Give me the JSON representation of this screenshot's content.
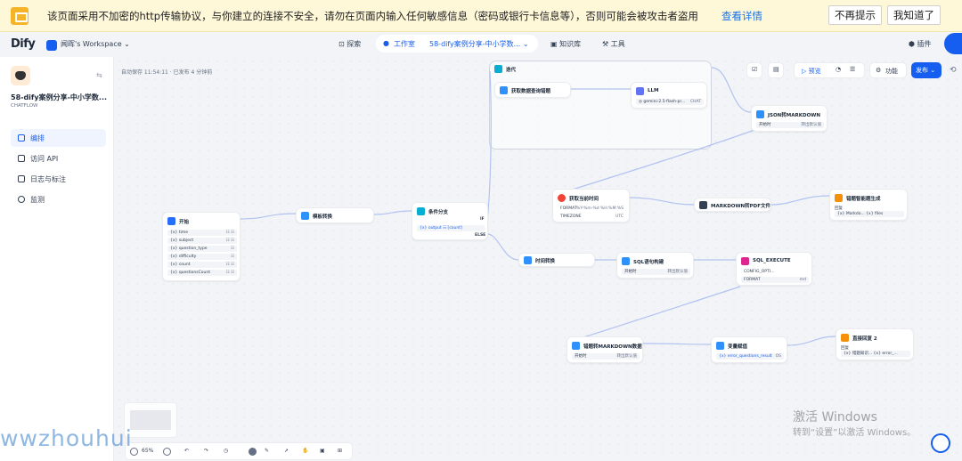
{
  "banner": {
    "text": "该页面采用不加密的http传输协议，与你建立的连接不安全，请勿在页面内输入任何敏感信息（密码或银行卡信息等），否则可能会被攻击者盗用",
    "link": "查看详情",
    "btn_dismiss": "不再提示",
    "btn_ok": "我知道了"
  },
  "topnav": {
    "logo": "Dify",
    "workspace": "闻晖's Workspace ⌄",
    "explore": "探索",
    "studio": "工作室",
    "app_breadcrumb": "58-dify案例分享-中小学数... ⌄",
    "knowledge": "知识库",
    "tools": "工具",
    "plugins": "插件"
  },
  "sidebar": {
    "app_title": "58-dify案例分享-中小学数...",
    "app_mode": "CHATFLOW",
    "items": [
      {
        "label": "编排"
      },
      {
        "label": "访问 API"
      },
      {
        "label": "日志与标注"
      },
      {
        "label": "监测"
      }
    ]
  },
  "canvas": {
    "autosave": "自动保存 11:54:11 · 已发布 4 分钟前",
    "toolbar": {
      "preview": "预览",
      "features": "功能",
      "publish": "发布 ⌄"
    },
    "nodes": {
      "start": {
        "title": "开始",
        "vars": [
          {
            "name": "{x} time",
            "type": "☷ ☷"
          },
          {
            "name": "{x} subject",
            "type": "☷ ☷"
          },
          {
            "name": "{x} question_type",
            "type": "☷"
          },
          {
            "name": "{x} difficulty",
            "type": "☷"
          },
          {
            "name": "{x} count",
            "type": "☷ ☷"
          },
          {
            "name": "{x} questionsCount",
            "type": "☷ ☷"
          }
        ]
      },
      "template": {
        "title": "模板转换"
      },
      "branch": {
        "title": "条件分支",
        "if": "IF",
        "cond": "{x} output ☷ [count]",
        "else": "ELSE"
      },
      "iteration": {
        "title": "迭代"
      },
      "fetch": {
        "title": "获取数据查询错题"
      },
      "llm": {
        "title": "LLM",
        "model": "gemini-2.5-flash-pr...",
        "model_tag": "CHAT"
      },
      "json_md": {
        "title": "JSON转MARKDOWN",
        "k": "开始时",
        "v": "转出默认值"
      },
      "gettime": {
        "title": "获取当前时间",
        "rows": [
          {
            "k": "FORMAT",
            "v": "%Y-%m-%d %H:%M:%S"
          },
          {
            "k": "TIMEZONE",
            "v": "UTC"
          }
        ]
      },
      "md_pdf": {
        "title": "MARKDOWN转PDF文件"
      },
      "reply1": {
        "title": "错题智能题生成",
        "label": "回复",
        "row": "{x} Markdo... {x} files"
      },
      "time_conv": {
        "title": "时间转换"
      },
      "sql_build": {
        "title": "SQL语句构建",
        "k": "开始时",
        "v": "转出默认值"
      },
      "sql_exec": {
        "title": "SQL_EXECUTE",
        "rows": [
          {
            "k": "CONFIG_OPTI...",
            "v": ""
          },
          {
            "k": "FORMAT",
            "v": "md"
          }
        ]
      },
      "qmd": {
        "title": "错题转MARKDOWN数据",
        "k": "开始时",
        "v": "转出默认值"
      },
      "var_assign": {
        "title": "变量赋值",
        "row": "{x} error_questions_result",
        "tag": "OS"
      },
      "reply2": {
        "title": "直接回复 2",
        "label": "回复",
        "row": "{x} 错题知识... {x} error_..."
      }
    },
    "bottom": {
      "zoom": "65%"
    }
  },
  "overlay": {
    "watermark": "wwzhouhui",
    "windows_line1": "激活 Windows",
    "windows_line2": "转到“设置”以激活 Windows。"
  },
  "colors": {
    "primary": "#155eef",
    "banner_bg": "#fef7d8",
    "canvas_bg": "#f2f4f7"
  }
}
